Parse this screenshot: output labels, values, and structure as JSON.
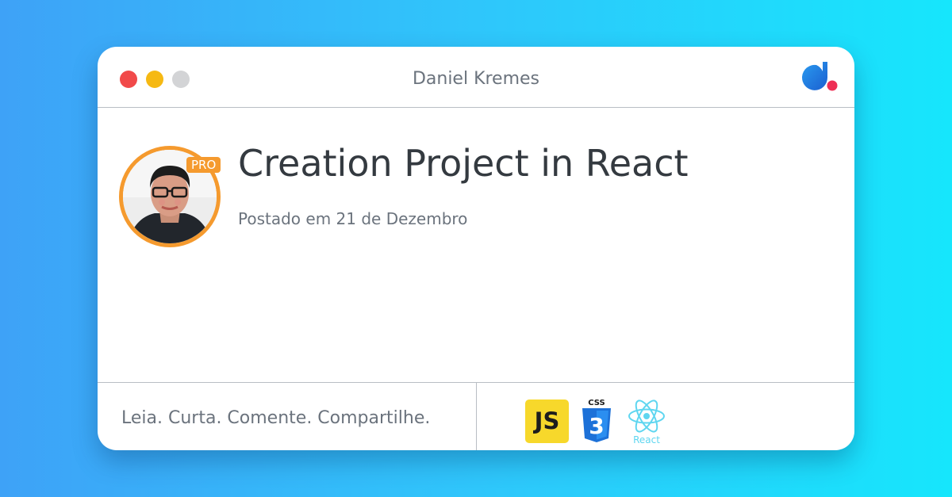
{
  "window": {
    "title": "Daniel Kremes",
    "controls": [
      {
        "name": "close",
        "color": "#f14a4a"
      },
      {
        "name": "minimize",
        "color": "#f6b913"
      },
      {
        "name": "maximize",
        "color": "#d3d4d6"
      }
    ]
  },
  "logo": {
    "icon": "brand-logo-icon",
    "colors": [
      "#1b7fe0",
      "#ee2f55"
    ]
  },
  "author": {
    "avatar_icon": "author-avatar",
    "badge": "PRO",
    "ring_color": "#f59a2e"
  },
  "post": {
    "title": "Creation Project in React",
    "date": "Postado em 21 de Dezembro"
  },
  "footer": {
    "slogan": "Leia. Curta. Comente. Compartilhe.",
    "tech": {
      "js_label": "JS",
      "css_label": "CSS",
      "css_number": "3",
      "react_label": "React"
    }
  },
  "colors": {
    "title_text": "#343a40",
    "muted_text": "#6b737d",
    "divider": "#b9bec4",
    "js_yellow": "#f7d82b",
    "css_blue": "#1d71d8",
    "react_cyan": "#5fd6f0"
  }
}
